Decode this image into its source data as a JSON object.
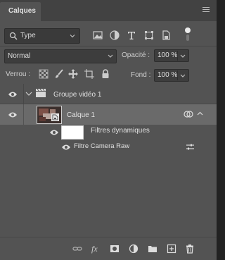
{
  "panel": {
    "tab_label": "Calques"
  },
  "filter": {
    "kind_label": "Type"
  },
  "blend": {
    "mode": "Normal",
    "opacity_label": "Opacité :",
    "opacity_value": "100 %",
    "fill_label": "Fond :",
    "fill_value": "100 %"
  },
  "lock": {
    "label": "Verrou :"
  },
  "layers": {
    "group_name": "Groupe vidéo 1",
    "layer_name": "Calque 1",
    "smart_filters_label": "Filtres dynamiques",
    "camera_raw_label": "Filtre Camera Raw"
  },
  "colors": {
    "panel_bg": "#535353",
    "selected_row": "#6a6a6a",
    "tab_bar": "#424242"
  }
}
